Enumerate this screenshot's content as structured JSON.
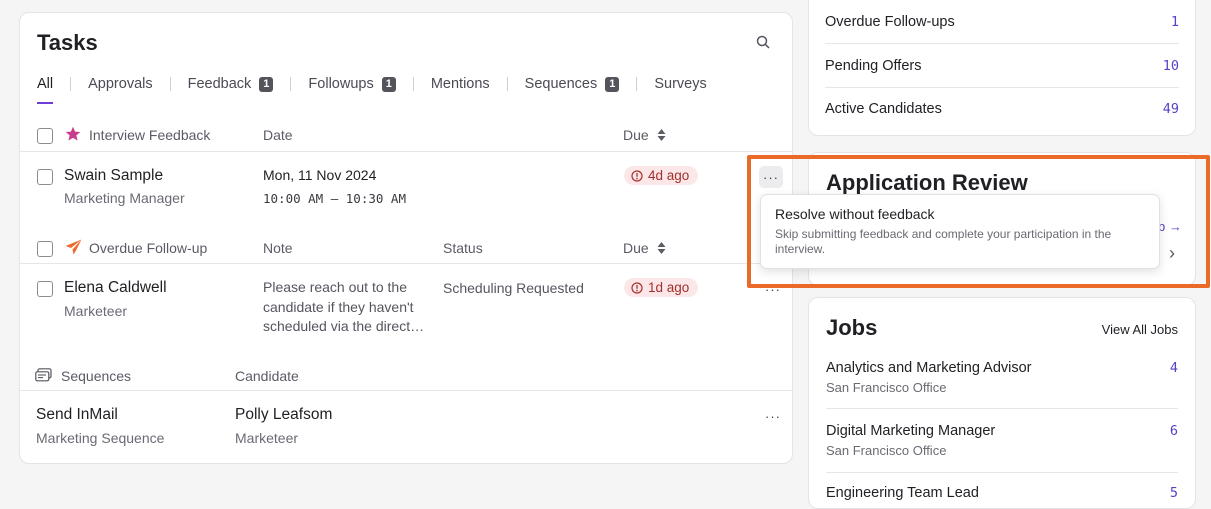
{
  "tasks": {
    "title": "Tasks",
    "tabs": [
      {
        "label": "All",
        "badge": ""
      },
      {
        "label": "Approvals",
        "badge": ""
      },
      {
        "label": "Feedback",
        "badge": "1"
      },
      {
        "label": "Followups",
        "badge": "1"
      },
      {
        "label": "Mentions",
        "badge": ""
      },
      {
        "label": "Sequences",
        "badge": "1"
      },
      {
        "label": "Surveys",
        "badge": ""
      }
    ],
    "interview_section": {
      "header": "Interview Feedback",
      "col_date": "Date",
      "col_due": "Due",
      "row": {
        "name": "Swain Sample",
        "role": "Marketing Manager",
        "date": "Mon, 11 Nov 2024",
        "time": "10:00 AM – 10:30 AM",
        "due": "4d ago",
        "more": "···"
      }
    },
    "followup_section": {
      "header": "Overdue Follow-up",
      "col_note": "Note",
      "col_status": "Status",
      "col_due": "Due",
      "row": {
        "name": "Elena Caldwell",
        "role": "Marketeer",
        "note": "Please reach out to the candidate if they haven't scheduled via the direct…",
        "status": "Scheduling Requested",
        "due": "1d ago",
        "more": "···"
      }
    },
    "sequence_section": {
      "header": "Sequences",
      "col_candidate": "Candidate",
      "row": {
        "name": "Send InMail",
        "sequence": "Marketing Sequence",
        "candidate": "Polly Leafsom",
        "candidate_role": "Marketeer",
        "more": "···"
      }
    }
  },
  "stats": [
    {
      "label": "Overdue Follow-ups",
      "value": "1"
    },
    {
      "label": "Pending Offers",
      "value": "10"
    },
    {
      "label": "Active Candidates",
      "value": "49"
    }
  ],
  "application_review": {
    "title": "Application Review",
    "partial_link": "b →",
    "chevron": "›"
  },
  "tooltip": {
    "title": "Resolve without feedback",
    "description": "Skip submitting feedback and complete your participation in the interview."
  },
  "jobs": {
    "title": "Jobs",
    "view_all": "View All Jobs",
    "items": [
      {
        "name": "Analytics and Marketing Advisor",
        "location": "San Francisco Office",
        "count": "4"
      },
      {
        "name": "Digital Marketing Manager",
        "location": "San Francisco Office",
        "count": "6"
      },
      {
        "name": "Engineering Team Lead",
        "location": "",
        "count": "5"
      }
    ]
  },
  "colors": {
    "accent": "#6d3fd6",
    "link": "#5a3fc8",
    "highlight": "#ea6a2a",
    "danger_bg": "#fbe7e7",
    "danger_text": "#a32f2f"
  }
}
